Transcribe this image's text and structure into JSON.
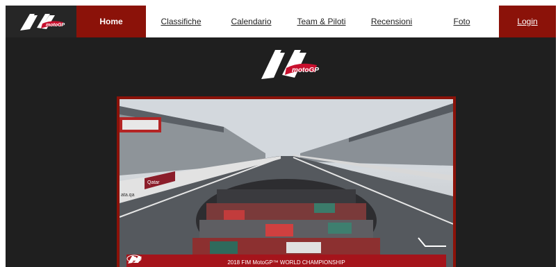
{
  "nav": {
    "home": "Home",
    "links": [
      "Classifiche",
      "Calendario",
      "Team & Piloti",
      "Recensioni",
      "Foto"
    ],
    "login": "Login"
  },
  "hero": {
    "banner_text": "2018 FIM MotoGP™ WORLD CHAMPIONSHIP",
    "signage_left": "Qatar",
    "signage_url": "ata.qa"
  },
  "colors": {
    "brand_red": "#8b1209",
    "background": "#1f1f1f",
    "nav_bg": "#ffffff"
  },
  "icons": {
    "brand": "motogp-logo"
  }
}
